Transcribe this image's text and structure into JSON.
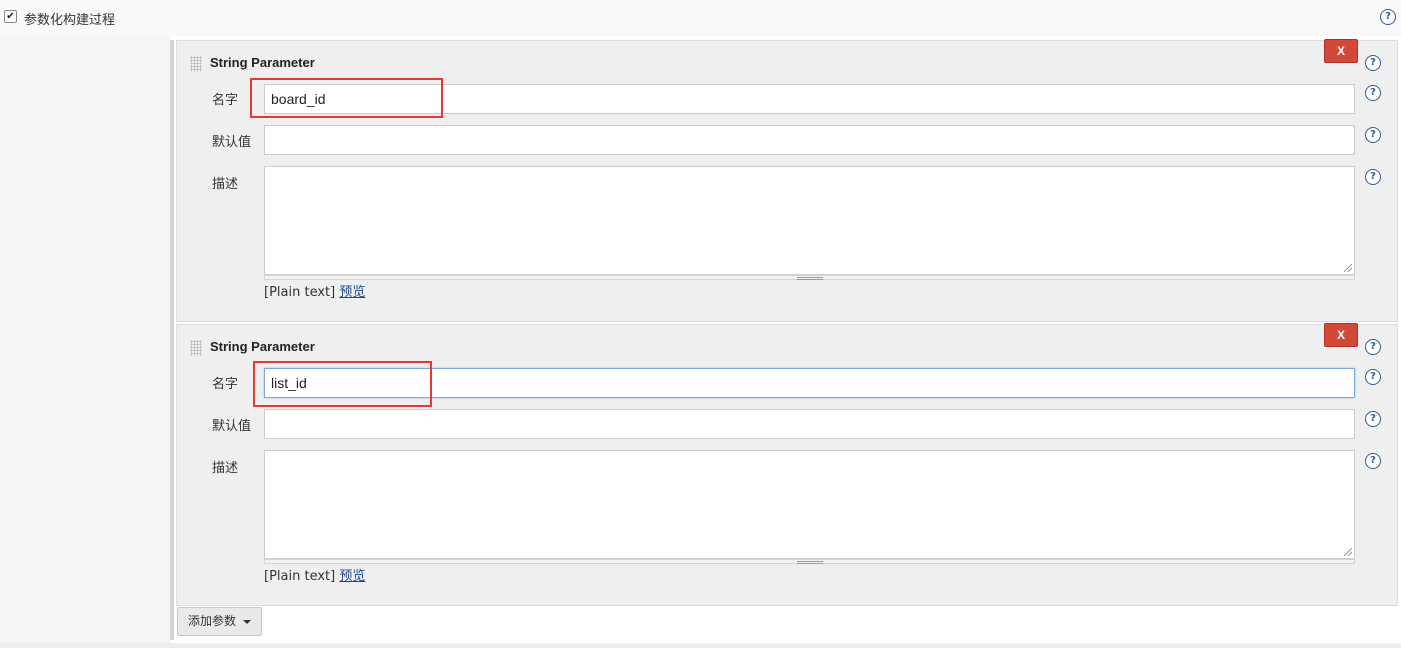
{
  "header": {
    "checkbox_checked": true,
    "checkbox_glyph": "✔",
    "label": "参数化构建过程",
    "help_glyph": "?"
  },
  "parameters": [
    {
      "title": "String Parameter",
      "delete_label": "X",
      "fields": {
        "name_label": "名字",
        "name_value": "board_id",
        "default_label": "默认值",
        "default_value": "",
        "description_label": "描述",
        "description_value": ""
      },
      "plain_text_label": "[Plain text]",
      "preview_label": "预览"
    },
    {
      "title": "String Parameter",
      "delete_label": "X",
      "fields": {
        "name_label": "名字",
        "name_value": "list_id",
        "default_label": "默认值",
        "default_value": "",
        "description_label": "描述",
        "description_value": ""
      },
      "plain_text_label": "[Plain text]",
      "preview_label": "预览"
    }
  ],
  "add_param_button": {
    "label": "添加参数",
    "icon": "caret-down-icon"
  },
  "colors": {
    "delete_button": "#d24939",
    "help_icon": "#2e5b95",
    "highlight": "#e53935",
    "link": "#204a87",
    "focus_border": "#7ea7dd"
  }
}
